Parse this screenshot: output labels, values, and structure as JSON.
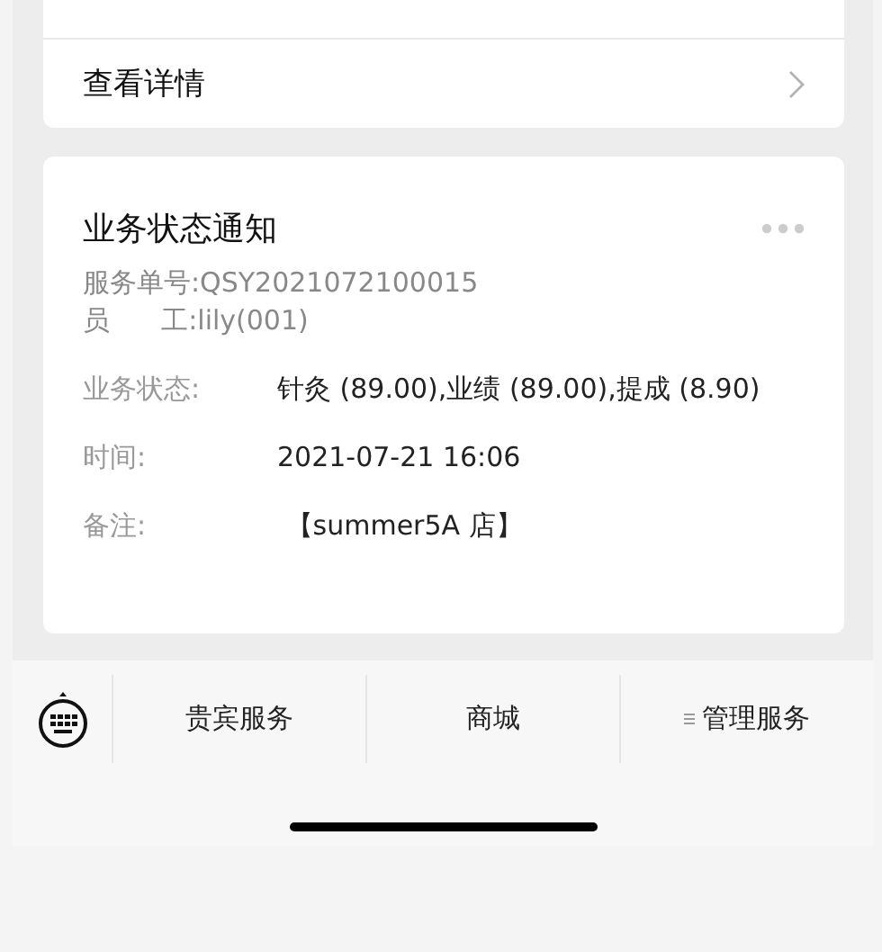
{
  "top_card": {
    "link": "查看详情"
  },
  "notice": {
    "title": "业务状态通知",
    "order_line": "服务单号:QSY2021072100015",
    "staff_line": "员      工:lily(001)",
    "fields": [
      {
        "label": "业务状态:",
        "value": "针灸 (89.00),业绩 (89.00),提成 (8.90)"
      },
      {
        "label": "时间:",
        "value": "2021-07-21 16:06"
      },
      {
        "label": "备注:",
        "value": " 【summer5A 店】"
      }
    ]
  },
  "menu": [
    {
      "label": "贵宾服务",
      "submenu": false
    },
    {
      "label": "商城",
      "submenu": false
    },
    {
      "label": "管理服务",
      "submenu": true
    }
  ]
}
